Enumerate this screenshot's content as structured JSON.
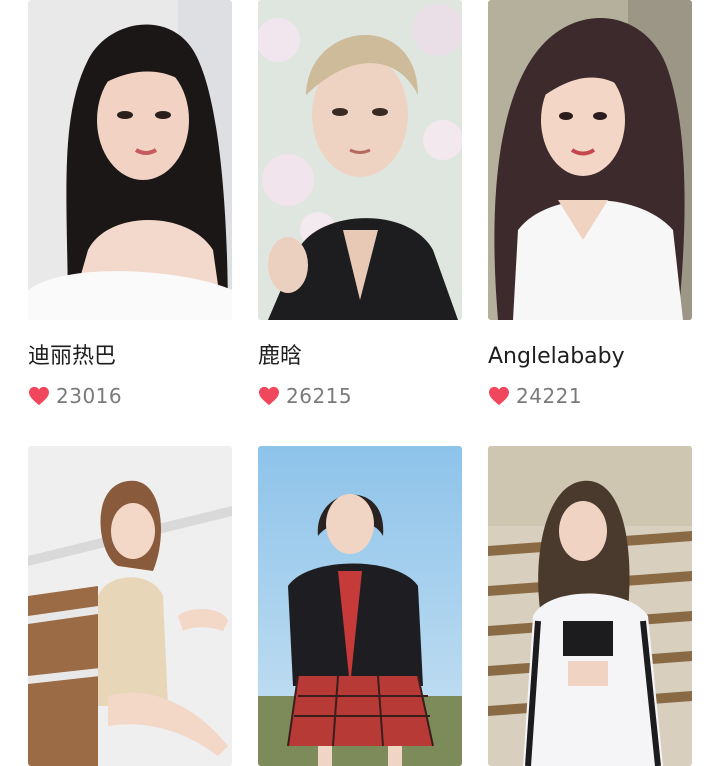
{
  "colors": {
    "heart": "#f0475c",
    "name_text": "#1e1e1e",
    "count_text": "#7a7a7a"
  },
  "icons": {
    "like": "heart-icon"
  },
  "cards": [
    {
      "name": "迪丽热巴",
      "likes": "23016"
    },
    {
      "name": "鹿晗",
      "likes": "26215"
    },
    {
      "name": "Anglelababy",
      "likes": "24221"
    },
    {
      "name": "",
      "likes": ""
    },
    {
      "name": "",
      "likes": ""
    },
    {
      "name": "",
      "likes": ""
    }
  ]
}
